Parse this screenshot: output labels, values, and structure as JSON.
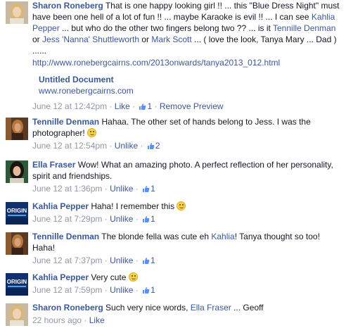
{
  "comments": [
    {
      "author": "Sharon Roneberg",
      "text_parts": [
        "That is one happy looking girl !! ... this \"Blue Dress Night\" must have been one hell of a lot of fun !! ... maybe Karaoke is evil !! ... I can see ",
        "Kahlia Pepper",
        " ... but who do the other two fingers belong two ?? ... is it ",
        "Tennille Denman",
        " or ",
        "Jess 'Nanna' Shuttleworth",
        " or ",
        "Mark Scott",
        " ... ( love the look, Tanya Mary ... Dad ) ......"
      ],
      "url": "http://www.ronebergcairns.com/2013onwards/tanya2013_012.html",
      "preview_title": "Untitled Document",
      "preview_domain": "www.ronebergcairns.com",
      "time": "June 12 at 12:42pm",
      "like_label": "Like",
      "likes": "1",
      "remove_label": "Remove Preview"
    },
    {
      "author": "Tennille Denman",
      "text": "Hahaa. The other set of hands belong to Jess. I was the photographer!",
      "time": "June 12 at 12:54pm",
      "like_label": "Unlike",
      "likes": "2"
    },
    {
      "author": "Ella Fraser",
      "text": "Wow! What an amazing photo. A perfect reflection of her personality, spirit and friendships.",
      "time": "June 12 at 1:36pm",
      "like_label": "Unlike",
      "likes": "1"
    },
    {
      "author": "Kahlia Pepper",
      "text": "Haha! I remember this",
      "time": "June 12 at 7:29pm",
      "like_label": "Unlike",
      "likes": "1"
    },
    {
      "author": "Tennille Denman",
      "text_before": "The blonde fella was cute eh ",
      "mention": "Kahlia",
      "text_after": "! Tanya thought so too! Haha!",
      "time": "June 12 at 7:37pm",
      "like_label": "Unlike",
      "likes": "1"
    },
    {
      "author": "Kahlia Pepper",
      "text": "Very cute",
      "time": "June 12 at 7:59pm",
      "like_label": "Unlike",
      "likes": "1"
    },
    {
      "author": "Sharon Roneberg",
      "text_before": "Such very nice words, ",
      "mention": "Ella Fraser",
      "text_after": " ... Geoff",
      "time": "22 hours ago",
      "like_label": "Like"
    }
  ],
  "colors": {
    "link": "#3b5998",
    "meta": "#9197a3",
    "text": "#141823"
  },
  "icons": {
    "like_count": "thumbs-up-icon",
    "smiley": "smiley-emoji-icon"
  }
}
